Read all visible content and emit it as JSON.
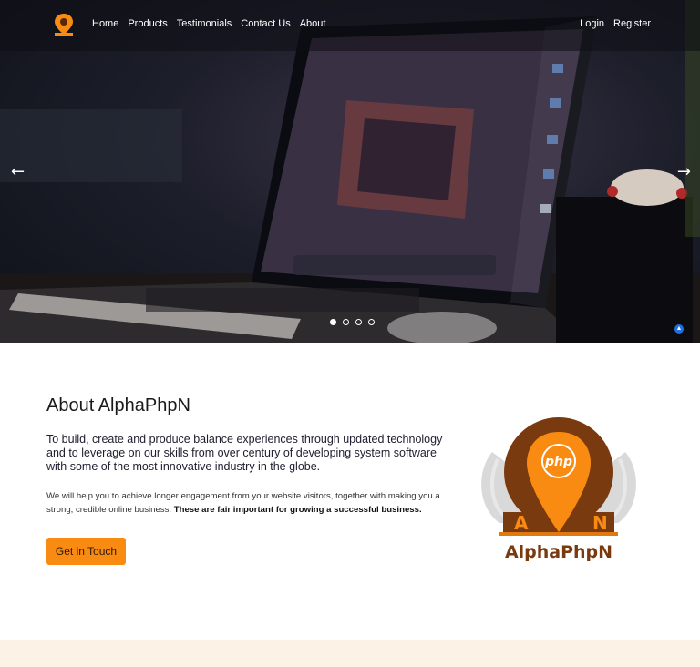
{
  "nav": {
    "brand_icon": "map-pin-logo-icon",
    "links": [
      "Home",
      "Products",
      "Testimonials",
      "Contact Us",
      "About"
    ],
    "login": "Login",
    "register": "Register"
  },
  "carousel": {
    "prev_symbol": "←",
    "next_symbol": "→",
    "slide_count": 4,
    "active_slide": 1
  },
  "about": {
    "title": "About AlphaPhpN",
    "lead": "To build, create and produce balance experiences through updated technology and to leverage on our skills from over century of developing system software with some of the most innovative industry in the globe.",
    "body_text": "We will help you to achieve longer engagement from your website visitors, together with making you a strong, credible online business.",
    "body_strong": "These are fair important for growing a successful business.",
    "cta_label": "Get in Touch"
  },
  "logo": {
    "php_text": "php",
    "wordmark": "AlphaPhpN",
    "banner_left": "A",
    "banner_right": "N"
  },
  "colors": {
    "accent": "#f98b12",
    "logo_brown": "#7a3a10",
    "strip": "#fdf2e6"
  }
}
